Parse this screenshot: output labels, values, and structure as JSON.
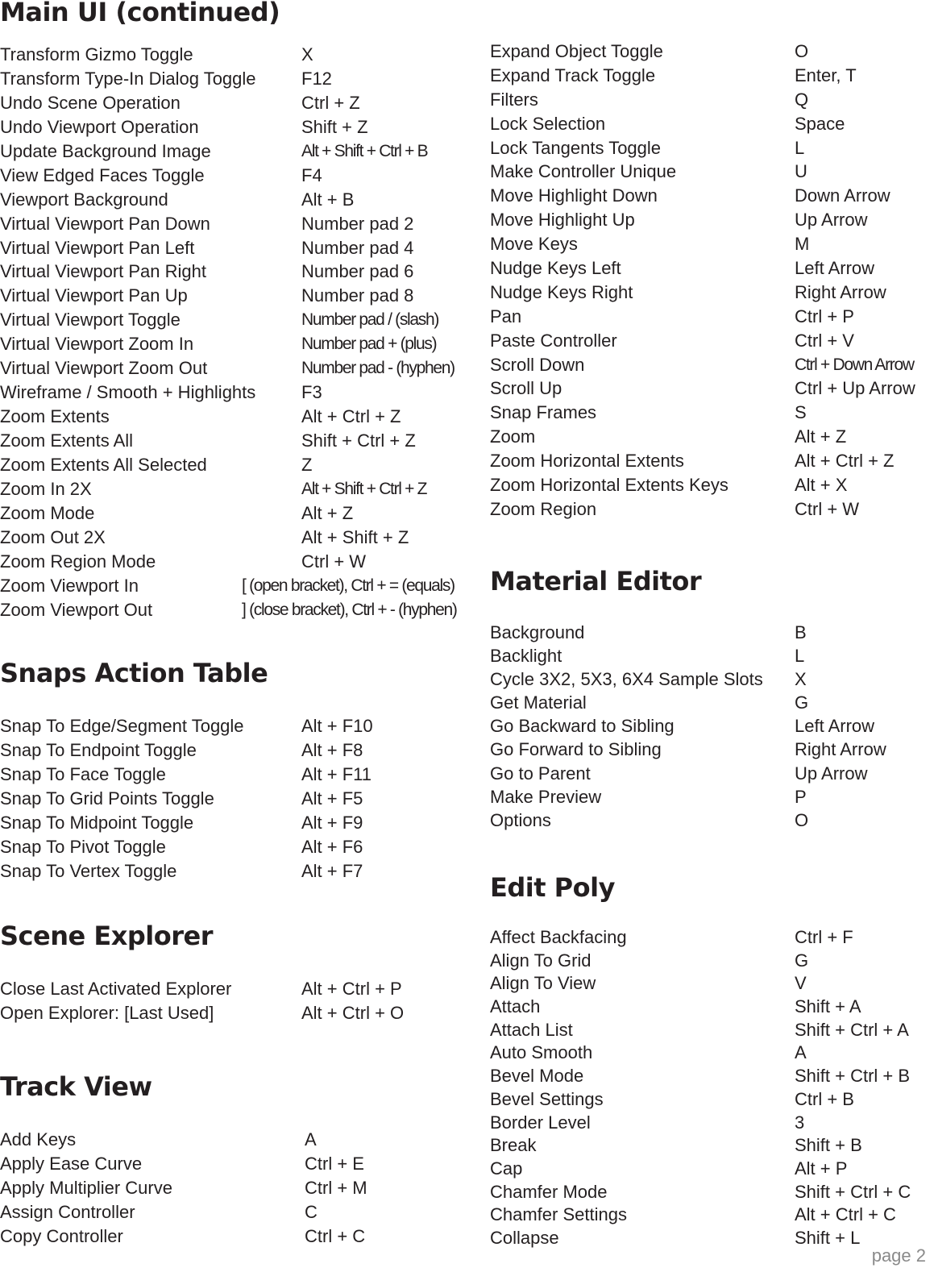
{
  "page_label": "page 2",
  "left_column": {
    "main_ui": {
      "title": "Main UI (continued)",
      "rows": [
        {
          "action": "Transform Gizmo Toggle",
          "key": "X"
        },
        {
          "action": "Transform Type-In Dialog Toggle",
          "key": "F12"
        },
        {
          "action": "Undo Scene Operation",
          "key": "Ctrl + Z"
        },
        {
          "action": "Undo Viewport Operation",
          "key": "Shift + Z"
        },
        {
          "action": "Update Background Image",
          "key": "Alt + Shift + Ctrl + B"
        },
        {
          "action": "View Edged Faces Toggle",
          "key": "F4"
        },
        {
          "action": "Viewport Background",
          "key": "Alt + B"
        },
        {
          "action": "Virtual Viewport Pan Down",
          "key": "Number pad 2"
        },
        {
          "action": "Virtual Viewport Pan Left",
          "key": "Number pad 4"
        },
        {
          "action": "Virtual Viewport Pan Right",
          "key": "Number pad 6"
        },
        {
          "action": "Virtual Viewport Pan Up",
          "key": "Number pad 8"
        },
        {
          "action": "Virtual Viewport Toggle",
          "key": "Number pad / (slash)"
        },
        {
          "action": "Virtual Viewport Zoom In",
          "key": "Number pad + (plus)"
        },
        {
          "action": "Virtual Viewport Zoom Out",
          "key": "Number pad - (hyphen)"
        },
        {
          "action": "Wireframe / Smooth + Highlights",
          "key": "F3"
        },
        {
          "action": "Zoom Extents",
          "key": "Alt + Ctrl + Z"
        },
        {
          "action": "Zoom Extents All",
          "key": "Shift + Ctrl + Z"
        },
        {
          "action": "Zoom Extents All Selected",
          "key": "Z"
        },
        {
          "action": "Zoom In 2X",
          "key": "Alt + Shift + Ctrl + Z"
        },
        {
          "action": "Zoom Mode",
          "key": "Alt + Z"
        },
        {
          "action": "Zoom Out 2X",
          "key": "Alt + Shift + Z"
        },
        {
          "action": "Zoom Region Mode",
          "key": "Ctrl + W"
        },
        {
          "action": "Zoom Viewport In",
          "key": "[ (open bracket), Ctrl + = (equals)"
        },
        {
          "action": "Zoom Viewport Out",
          "key": "] (close bracket), Ctrl + - (hyphen)"
        }
      ]
    },
    "snaps": {
      "title": "Snaps Action Table",
      "rows": [
        {
          "action": "Snap To Edge/Segment Toggle",
          "key": "Alt + F10"
        },
        {
          "action": "Snap To Endpoint Toggle",
          "key": "Alt + F8"
        },
        {
          "action": "Snap To Face Toggle",
          "key": "Alt + F11"
        },
        {
          "action": "Snap To Grid Points Toggle",
          "key": "Alt + F5"
        },
        {
          "action": "Snap To Midpoint Toggle",
          "key": "Alt + F9"
        },
        {
          "action": "Snap To Pivot Toggle",
          "key": "Alt + F6"
        },
        {
          "action": "Snap To Vertex Toggle",
          "key": "Alt + F7"
        }
      ]
    },
    "scene_explorer": {
      "title": "Scene Explorer",
      "rows": [
        {
          "action": "Close Last Activated Explorer",
          "key": "Alt + Ctrl + P"
        },
        {
          "action": "Open Explorer: [Last Used]",
          "key": "Alt + Ctrl + O"
        }
      ]
    },
    "track_view": {
      "title": "Track View",
      "rows": [
        {
          "action": "Add Keys",
          "key": "A"
        },
        {
          "action": "Apply Ease Curve",
          "key": "Ctrl + E"
        },
        {
          "action": "Apply Multiplier Curve",
          "key": "Ctrl + M"
        },
        {
          "action": "Assign Controller",
          "key": "C"
        },
        {
          "action": "Copy Controller",
          "key": "Ctrl + C"
        }
      ]
    }
  },
  "right_column": {
    "track_view_cont": {
      "rows": [
        {
          "action": "Expand Object Toggle",
          "key": "O"
        },
        {
          "action": "Expand Track Toggle",
          "key": "Enter, T"
        },
        {
          "action": "Filters",
          "key": "Q"
        },
        {
          "action": "Lock Selection",
          "key": "Space"
        },
        {
          "action": "Lock Tangents Toggle",
          "key": "L"
        },
        {
          "action": "Make Controller Unique",
          "key": "U"
        },
        {
          "action": "Move Highlight Down",
          "key": "Down Arrow"
        },
        {
          "action": "Move Highlight Up",
          "key": "Up Arrow"
        },
        {
          "action": "Move Keys",
          "key": "M"
        },
        {
          "action": "Nudge Keys Left",
          "key": "Left Arrow"
        },
        {
          "action": "Nudge Keys Right",
          "key": "Right Arrow"
        },
        {
          "action": "Pan",
          "key": "Ctrl + P"
        },
        {
          "action": "Paste Controller",
          "key": "Ctrl + V"
        },
        {
          "action": "Scroll Down",
          "key": "Ctrl + Down Arrow"
        },
        {
          "action": "Scroll Up",
          "key": "Ctrl + Up Arrow"
        },
        {
          "action": "Snap Frames",
          "key": "S"
        },
        {
          "action": "Zoom",
          "key": "Alt + Z"
        },
        {
          "action": "Zoom Horizontal Extents",
          "key": "Alt + Ctrl + Z"
        },
        {
          "action": "Zoom Horizontal Extents Keys",
          "key": "Alt + X"
        },
        {
          "action": "Zoom Region",
          "key": "Ctrl + W"
        }
      ]
    },
    "material_editor": {
      "title": "Material Editor",
      "rows": [
        {
          "action": "Background",
          "key": "B"
        },
        {
          "action": "Backlight",
          "key": "L"
        },
        {
          "action": "Cycle 3X2, 5X3, 6X4 Sample Slots",
          "key": "X"
        },
        {
          "action": "Get Material",
          "key": "G"
        },
        {
          "action": "Go Backward to Sibling",
          "key": "Left Arrow"
        },
        {
          "action": "Go Forward to Sibling",
          "key": "Right Arrow"
        },
        {
          "action": "Go to Parent",
          "key": "Up Arrow"
        },
        {
          "action": "Make Preview",
          "key": "P"
        },
        {
          "action": "Options",
          "key": "O"
        }
      ]
    },
    "edit_poly": {
      "title": "Edit Poly",
      "rows": [
        {
          "action": "Affect Backfacing",
          "key": "Ctrl  + F"
        },
        {
          "action": "Align To Grid",
          "key": "G"
        },
        {
          "action": "Align To View",
          "key": "V"
        },
        {
          "action": "Attach",
          "key": "Shift  +  A"
        },
        {
          "action": "Attach List",
          "key": "Shift  + Ctrl + A"
        },
        {
          "action": "Auto Smooth",
          "key": "A"
        },
        {
          "action": "Bevel Mode",
          "key": "Shift  + Ctrl + B"
        },
        {
          "action": "Bevel Settings",
          "key": "Ctrl + B"
        },
        {
          "action": "Border Level",
          "key": "3"
        },
        {
          "action": "Break",
          "key": "Shift + B"
        },
        {
          "action": "Cap",
          "key": "Alt + P"
        },
        {
          "action": "Chamfer Mode",
          "key": "Shift + Ctrl + C"
        },
        {
          "action": "Chamfer Settings",
          "key": "Alt + Ctrl + C"
        },
        {
          "action": "Collapse",
          "key": "Shift + L"
        }
      ]
    }
  }
}
